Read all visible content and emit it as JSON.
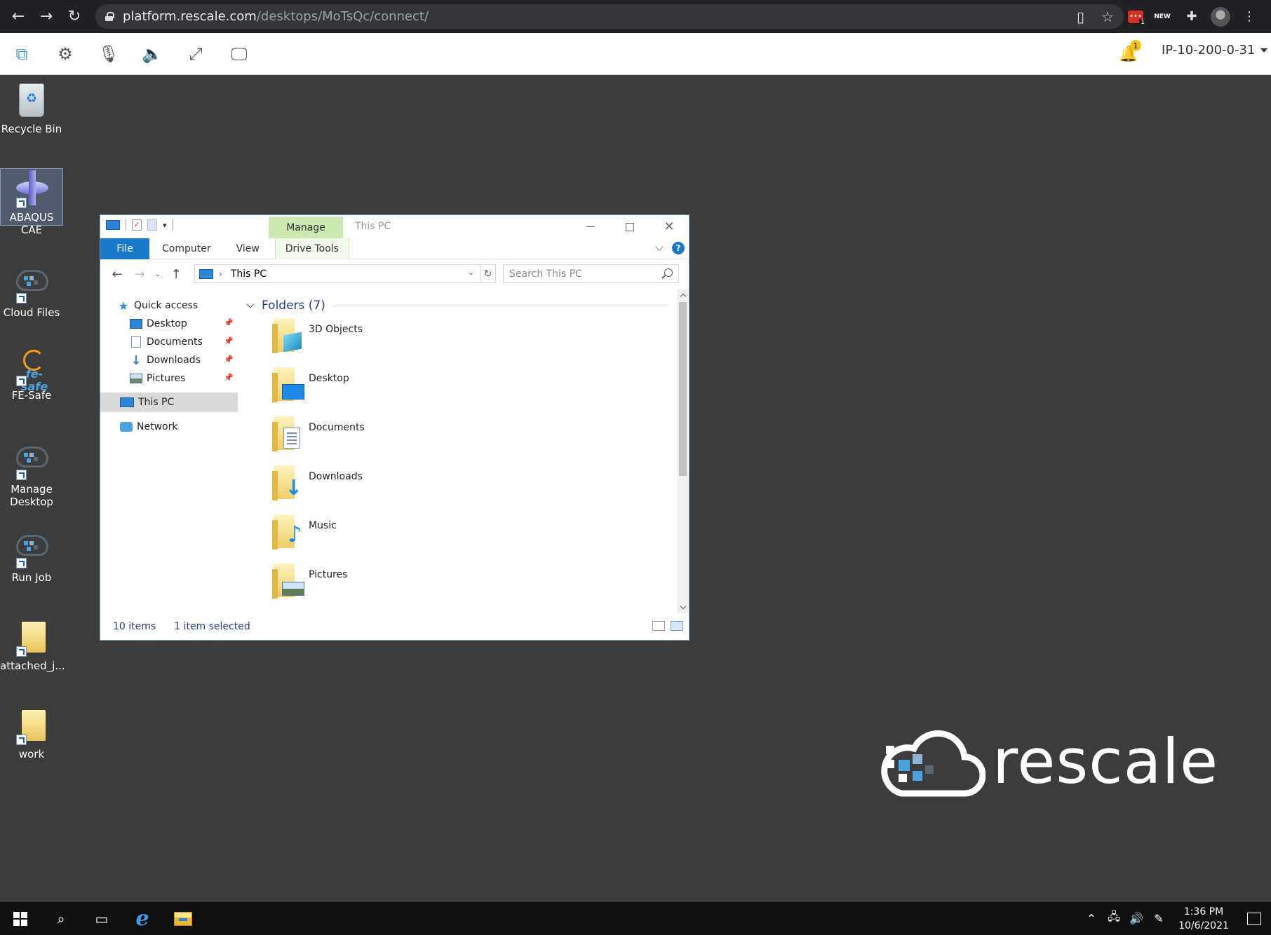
{
  "browser": {
    "url_host": "platform.rescale.com",
    "url_path": "/desktops/MoTsQc/connect/",
    "ext_badge": "1",
    "ext_new_label": "NEW"
  },
  "rescale_toolbar": {
    "notification_count": "1",
    "host_label": "IP-10-200-0-31"
  },
  "desktop_icons": [
    {
      "label": "Recycle Bin"
    },
    {
      "label": "ABAQUS CAE"
    },
    {
      "label": "Cloud Files"
    },
    {
      "label": "FE-Safe"
    },
    {
      "label": "Manage Desktop"
    },
    {
      "label": "Run Job"
    },
    {
      "label": "attached_j..."
    },
    {
      "label": "work"
    }
  ],
  "fesafe_logo_text": "fe-safe",
  "watermark": {
    "word": "rescale"
  },
  "explorer": {
    "window_title": "This PC",
    "context_tab_group": "Manage",
    "ribbon_tabs": [
      "File",
      "Computer",
      "View",
      "Drive Tools"
    ],
    "address_crumb": "This PC",
    "search_placeholder": "Search This PC",
    "nav": {
      "quick_access": "Quick access",
      "quick_items": [
        "Desktop",
        "Documents",
        "Downloads",
        "Pictures"
      ],
      "this_pc": "This PC",
      "network": "Network"
    },
    "group_header": "Folders (7)",
    "folders": [
      "3D Objects",
      "Desktop",
      "Documents",
      "Downloads",
      "Music",
      "Pictures"
    ],
    "status_items": "10 items",
    "status_selected": "1 item selected"
  },
  "taskbar": {
    "time": "1:36 PM",
    "date": "10/6/2021"
  }
}
